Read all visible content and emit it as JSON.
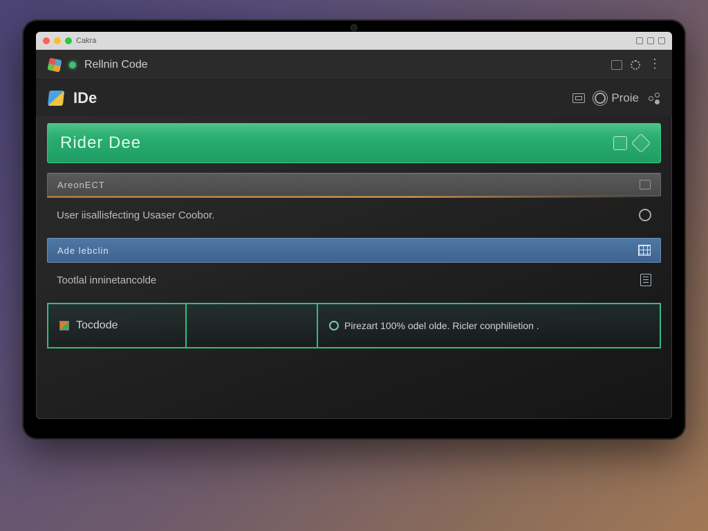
{
  "os": {
    "title": "Cakra"
  },
  "tabbar": {
    "title": "Rellnin Code"
  },
  "appbar": {
    "brand": "IDe",
    "menu_project": "Proie"
  },
  "banner": {
    "title": "Rider Dee"
  },
  "section_a": {
    "label": "AreonECT",
    "body": "User iisallisfecting Usaser Coobor."
  },
  "section_b": {
    "label": "Ade lebclin",
    "body": "Tootlal inninetancolde"
  },
  "bottom_panel": {
    "left_label": "Tocdode",
    "status_text": "Pirezart 100% odel olde. Ricler conphilietion ."
  }
}
